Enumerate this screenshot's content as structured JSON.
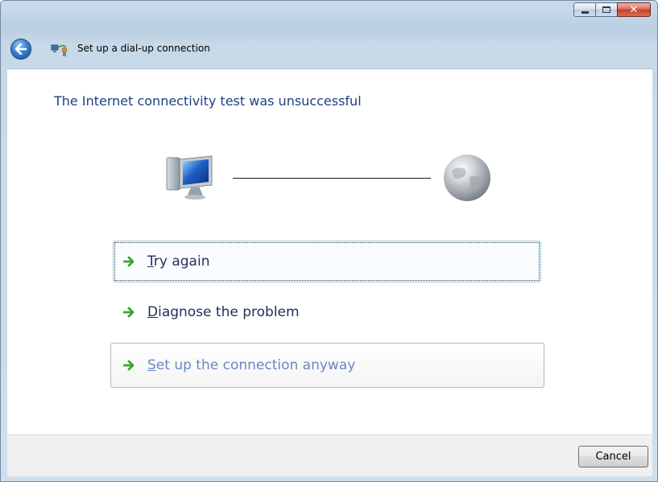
{
  "window": {
    "title": "Set up a dial-up connection",
    "caption_buttons": {
      "minimize_icon": "minimize-icon",
      "maximize_icon": "maximize-icon",
      "close_symbol": "✕"
    }
  },
  "main": {
    "heading": "The Internet connectivity test was unsuccessful",
    "icons": [
      "computer-icon",
      "globe-icon"
    ],
    "options": [
      {
        "mnemonic": "T",
        "rest": "ry again",
        "state": "focused"
      },
      {
        "mnemonic": "D",
        "rest": "iagnose the problem",
        "state": "normal"
      },
      {
        "mnemonic": "S",
        "rest": "et up the connection anyway",
        "state": "hover"
      }
    ]
  },
  "footer": {
    "cancel_label": "Cancel"
  },
  "colors": {
    "heading": "#1f3e85",
    "option_text": "#1f2f58",
    "option_hover_text": "#6a86c4",
    "arrow_green": "#3aa62e"
  }
}
